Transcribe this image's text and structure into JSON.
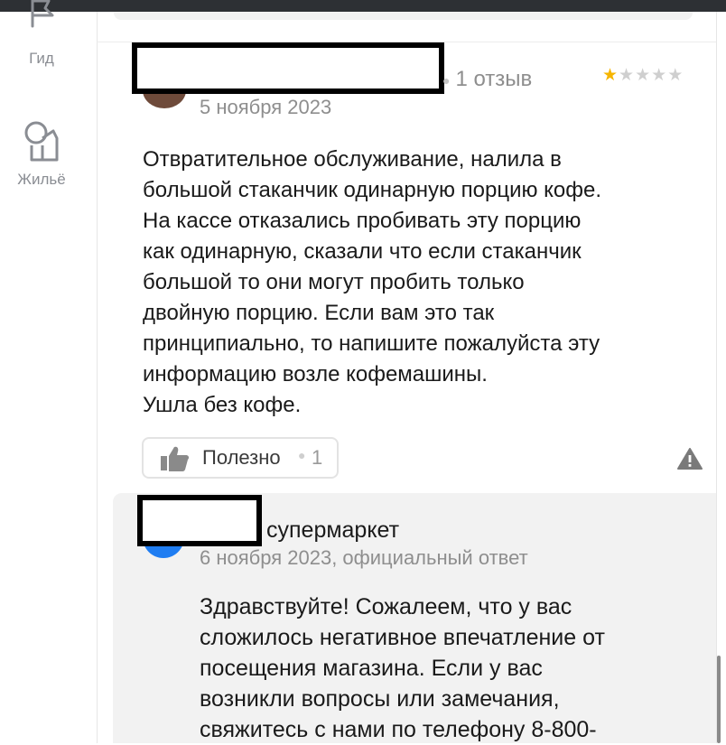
{
  "sidebar": {
    "items": [
      {
        "label": "Гид",
        "icon": "flag-icon"
      },
      {
        "label": "Жильё",
        "icon": "house-icon"
      }
    ]
  },
  "review": {
    "reviews_count": "1 отзыв",
    "rating": 1,
    "rating_max": 5,
    "date": "5 ноября 2023",
    "text": [
      "Отвратительное обслуживание, налила в",
      "большой стаканчик одинарную порцию кофе.",
      "На кассе отказались пробивать эту порцию",
      "как одинарную, сказали что если стаканчик",
      "большой то они могут пробить только",
      "двойную порцию. Если вам это так",
      "принципиально, то напишите пожалуйста эту",
      "информацию возле кофемашины.",
      "Ушла без кофе."
    ],
    "helpful_label": "Полезно",
    "helpful_count": "1"
  },
  "reply": {
    "name_suffix": "супермаркет",
    "date_line": "6 ноября 2023, официальный ответ",
    "text": [
      "Здравствуйте! Сожалеем, что у вас",
      "сложилось негативное впечатление от",
      "посещения магазина. Если у вас",
      "возникли вопросы или замечания,",
      "свяжитесь с нами по телефону 8-800-"
    ]
  },
  "colors": {
    "star_active": "#f6b500",
    "star_inactive": "#cfcfcf",
    "reply_avatar": "#1f7df2",
    "muted_text": "#8e8e8e"
  }
}
